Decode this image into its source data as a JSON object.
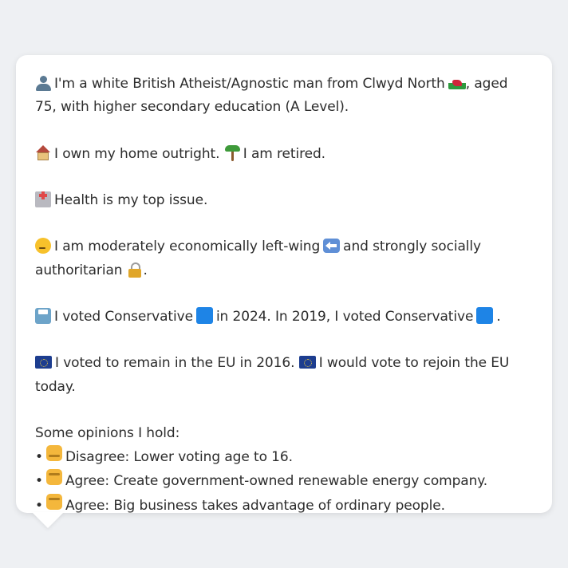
{
  "profile": {
    "intro_text_1": "I'm a white British Atheist/Agnostic man from Clwyd North",
    "intro_text_2": ", aged 75, with higher secondary education (A Level).",
    "housing_text": "I own my home outright.",
    "retired_text": "I am retired.",
    "issue_text": "Health is my top issue.",
    "ideology_text_1": "I am moderately economically left-wing",
    "ideology_text_2": "and strongly socially authoritarian",
    "ideology_text_3": ".",
    "vote_text_1": "I voted Conservative",
    "vote_text_2": "in 2024. In 2019, I voted Conservative",
    "vote_text_3": ".",
    "eu_text_1": "I voted to remain in the EU in 2016.",
    "eu_text_2": "I would vote to rejoin the EU today.",
    "opinions_heading": "Some opinions I hold:",
    "opinions": [
      {
        "bullet": "•",
        "icon": "thumbs-down-icon",
        "text": "Disagree: Lower voting age to 16."
      },
      {
        "bullet": "•",
        "icon": "thumbs-up-icon",
        "text": "Agree: Create government-owned renewable energy company."
      },
      {
        "bullet": "•",
        "icon": "thumbs-up-icon",
        "text": "Agree: Big business takes advantage of ordinary people."
      }
    ]
  },
  "colors": {
    "background": "#eef0f3",
    "bubble": "#ffffff",
    "text": "#2c2c2c",
    "party_blue": "#1e84e6"
  }
}
